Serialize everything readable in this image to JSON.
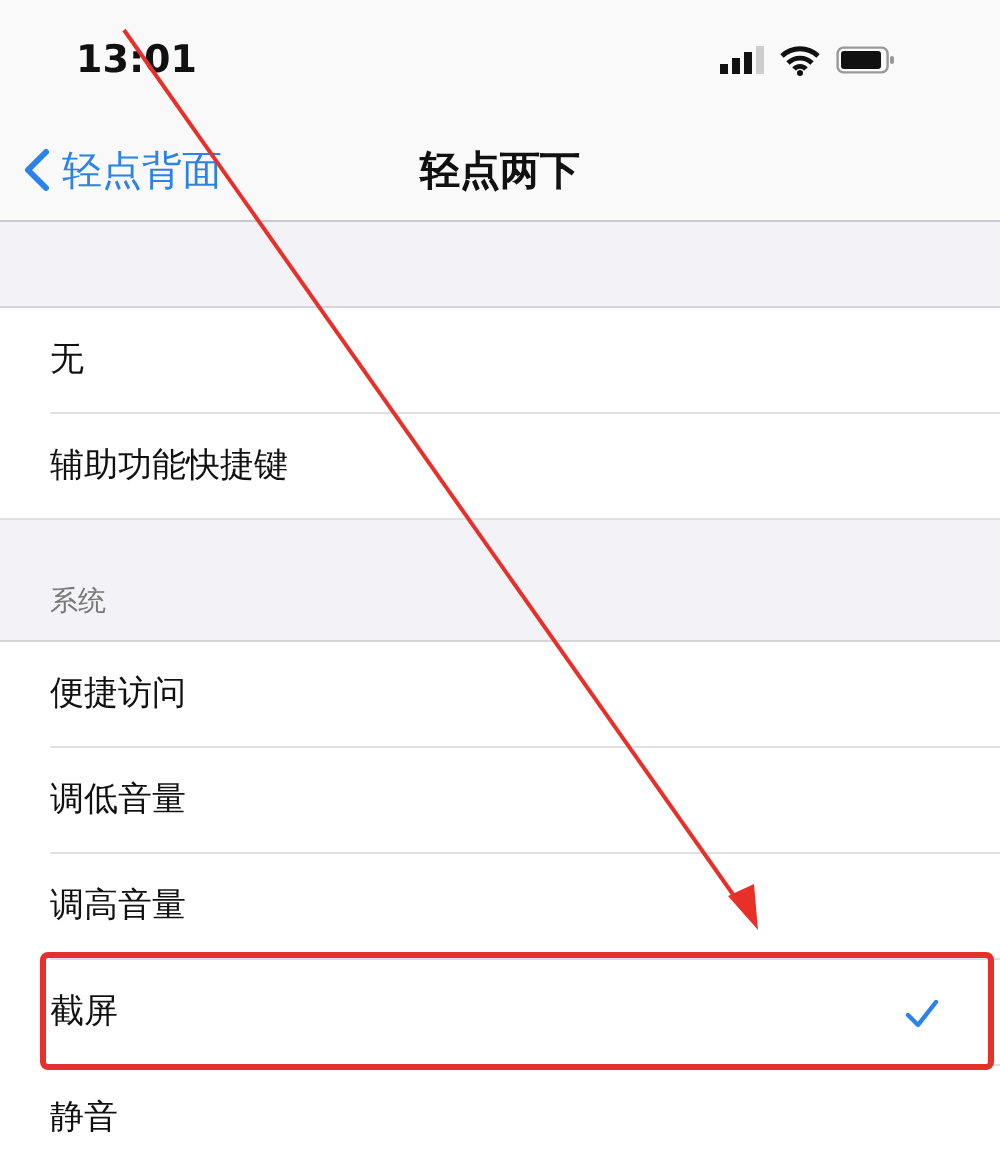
{
  "status_bar": {
    "time": "13:01"
  },
  "nav": {
    "back": "轻点背面",
    "title": "轻点两下"
  },
  "groups": [
    {
      "items": [
        {
          "label": "无",
          "selected": false,
          "framed": false
        },
        {
          "label": "辅助功能快捷键",
          "selected": false,
          "framed": false
        }
      ]
    },
    {
      "header": "系统",
      "items": [
        {
          "label": "便捷访问",
          "selected": false,
          "framed": false
        },
        {
          "label": "调低音量",
          "selected": false,
          "framed": false
        },
        {
          "label": "调高音量",
          "selected": false,
          "framed": false
        },
        {
          "label": "截屏",
          "selected": true,
          "framed": true
        },
        {
          "label": "静音",
          "selected": false,
          "framed": false
        }
      ]
    }
  ],
  "annotations": [
    {
      "kind": "arrow"
    }
  ]
}
